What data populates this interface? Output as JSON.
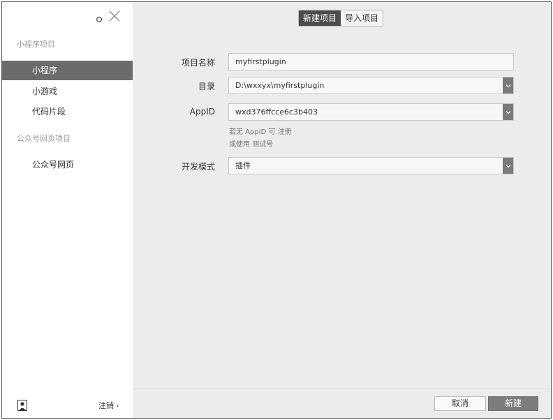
{
  "sidebar": {
    "section_miniprogram": "小程序项目",
    "items_mp": [
      {
        "label": "小程序"
      },
      {
        "label": "小游戏"
      },
      {
        "label": "代码片段"
      }
    ],
    "section_official": "公众号网页项目",
    "items_official": [
      {
        "label": "公众号网页"
      }
    ],
    "logout_label": "注销",
    "logout_arrow": "›"
  },
  "tabs": [
    {
      "label": "新建项目"
    },
    {
      "label": "导入项目"
    }
  ],
  "form": {
    "name_label": "项目名称",
    "name_value": "myfirstplugin",
    "dir_label": "目录",
    "dir_value": "D:\\wxxyx\\myfirstplugin",
    "appid_label": "AppID",
    "appid_value": "wxd376ffcce6c3b403",
    "hint_line1_prefix": "若无 AppID 可",
    "hint_register": "注册",
    "hint_line2_prefix": "或使用",
    "hint_testid": "测试号",
    "mode_label": "开发模式",
    "mode_value": "插件"
  },
  "footer": {
    "cancel_label": "取消",
    "create_label": "新建"
  },
  "colors": {
    "active_item_bg": "#6b6b6b",
    "active_tab_bg": "#4c4c4c",
    "create_button_bg": "#7c7c7c",
    "main_bg": "#ececec"
  },
  "icons": {
    "settings": "gear-icon",
    "close": "close-icon",
    "avatar": "user-avatar-icon",
    "dropdown": "chevron-down-icon"
  }
}
